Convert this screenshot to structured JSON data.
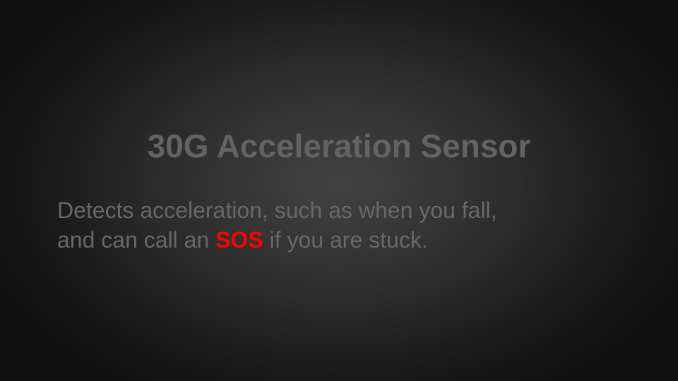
{
  "slide": {
    "title": "30G Acceleration Sensor",
    "body_line1": "Detects acceleration, such as when you fall,",
    "body_line2_before": "and can call an ",
    "body_line2_highlight": "SOS",
    "body_line2_after": " if you are stuck.",
    "highlight_color": "#ff0000"
  }
}
